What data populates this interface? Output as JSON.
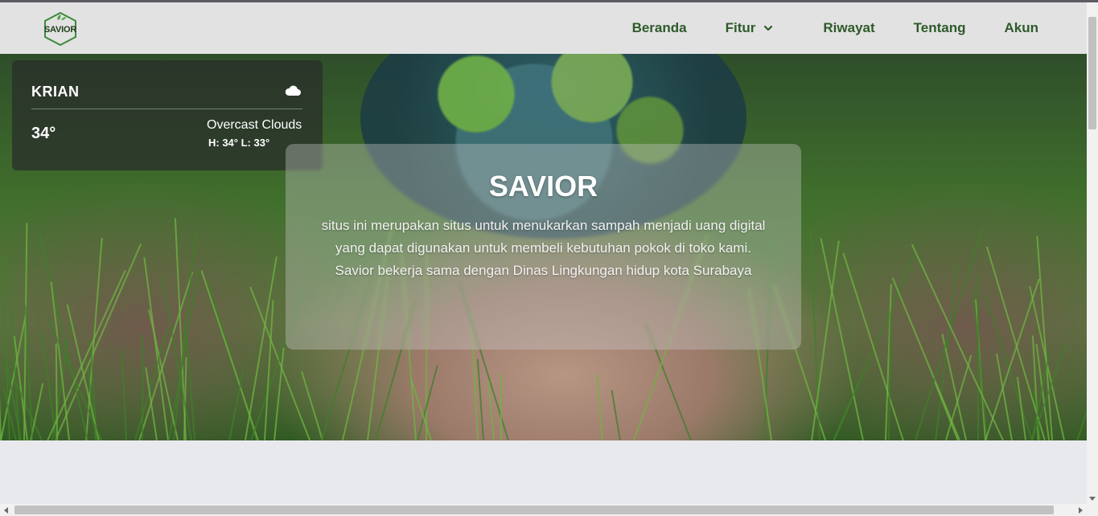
{
  "brand": {
    "logo_text": "SAVIOR"
  },
  "nav": {
    "items": [
      {
        "label": "Beranda"
      },
      {
        "label": "Fitur"
      },
      {
        "label": "Riwayat"
      },
      {
        "label": "Tentang"
      },
      {
        "label": "Akun"
      }
    ]
  },
  "weather": {
    "city": "KRIAN",
    "temperature": "34°",
    "condition": "Overcast Clouds",
    "high_low": "H: 34° L: 33°",
    "icon": "cloud-icon"
  },
  "hero": {
    "title": "SAVIOR",
    "description": "situs ini merupakan situs untuk menukarkan sampah menjadi uang digital yang dapat digunakan untuk membeli kebutuhan pokok di toko kami. Savior bekerja sama dengan Dinas Lingkungan hidup kota Surabaya"
  },
  "colors": {
    "nav_text": "#2e5a2a",
    "navbar_bg": "#e2e2e2",
    "page_bg": "#e8e9ec"
  }
}
